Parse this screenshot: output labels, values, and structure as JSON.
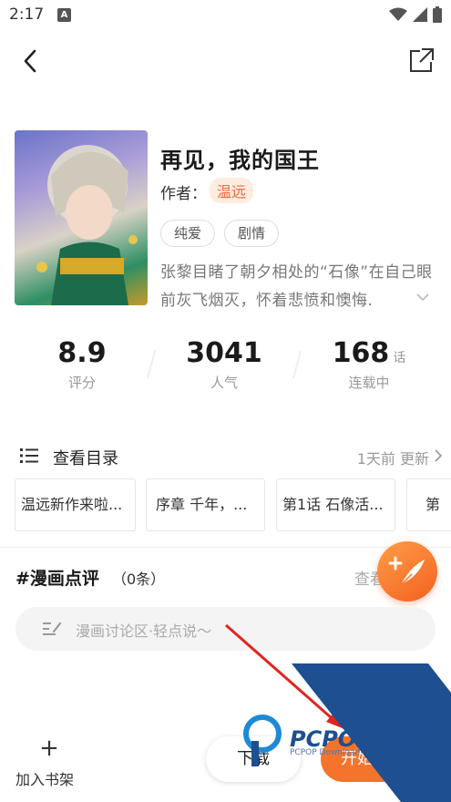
{
  "status_bar": {
    "time": "2:17",
    "notification_glyph": "A",
    "icons": [
      "wifi-icon",
      "signal-icon",
      "battery-icon"
    ]
  },
  "nav": {
    "back_icon": "chevron-left-icon",
    "share_icon": "share-icon"
  },
  "book": {
    "title": "再见，我的国王",
    "author_label": "作者：",
    "author_name": "温远",
    "tags": [
      "纯爱",
      "剧情"
    ],
    "synopsis": "张黎目睹了朝夕相处的“石像”在自己眼前灰飞烟灭，怀着悲愤和懊悔."
  },
  "stats": {
    "rating_value": "8.9",
    "rating_label": "评分",
    "popularity_value": "3041",
    "popularity_label": "人气",
    "episodes_value": "168",
    "episodes_unit": "话",
    "episodes_label": "连载中"
  },
  "catalog": {
    "title": "查看目录",
    "update_text": "1天前 更新",
    "chapters": [
      "温远新作来啦...",
      "序章  千年，...",
      "第1话  石像活...",
      "第"
    ]
  },
  "reviews": {
    "title": "#漫画点评",
    "count": "（0条）",
    "view_all": "查看",
    "input_placeholder": "漫画讨论区·轻点说～"
  },
  "bottom": {
    "shelf_plus": "+",
    "shelf_label": "加入书架",
    "download_label": "下载",
    "start_label": "开始"
  },
  "watermark": {
    "brand": "PCPOP下载",
    "sub": "PCPOP Download"
  },
  "colors": {
    "accent": "#f4742b",
    "author_tag_bg": "#fdecdf",
    "author_tag_text": "#f06a3c",
    "watermark_blue": "#1d4f91"
  }
}
